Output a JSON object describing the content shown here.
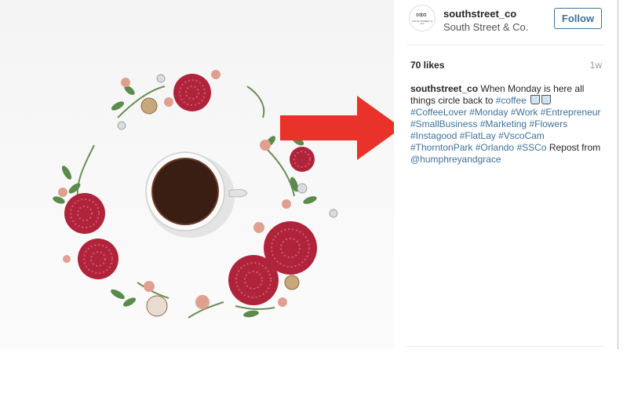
{
  "post": {
    "username": "southstreet_co",
    "full_name": "South Street & Co.",
    "follow_label": "Follow",
    "likes": "70 likes",
    "age": "1w",
    "avatar": {
      "mark": "∞∞",
      "text": "SOUTH STREET & CO."
    },
    "caption": {
      "user": "southstreet_co",
      "text_1": " When Monday is here all things circle back to ",
      "tag_coffee": "#coffee",
      "tag_coffeelover": "#CoffeeLover",
      "tag_monday": "#Monday",
      "tag_work": "#Work",
      "tag_entrepreneur": "#Entrepreneur",
      "tag_smallbusiness": "#SmallBusiness",
      "tag_marketing": "#Marketing",
      "tag_flowers": "#Flowers",
      "tag_instagood": "#Instagood",
      "tag_flatlay": "#FlatLay",
      "tag_vscocam": "#VscoCam",
      "tag_thorntonpark": "#ThorntonPark",
      "tag_orlando": "#Orlando",
      "tag_ssco": "#SSCo",
      "text_repost": " Repost from ",
      "mention": "@humphreyandgrace"
    }
  },
  "colors": {
    "link": "#3f729b",
    "arrow": "#e8322a",
    "flower": "#b0243b",
    "leaf": "#5b8a4a",
    "coffee": "#3a1e14"
  },
  "icons": [
    "coffee-cup-emoji",
    "annotation-arrow"
  ]
}
